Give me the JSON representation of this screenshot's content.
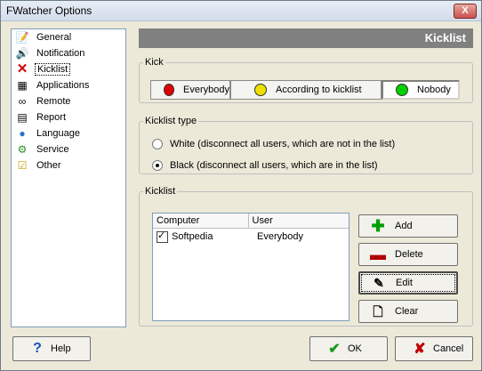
{
  "window": {
    "title": "FWatcher Options",
    "close_label": "X"
  },
  "nav": {
    "items": [
      {
        "label": "General",
        "icon": "general-icon"
      },
      {
        "label": "Notification",
        "icon": "speaker-icon"
      },
      {
        "label": "Kicklist",
        "icon": "x-icon"
      },
      {
        "label": "Applications",
        "icon": "applications-icon"
      },
      {
        "label": "Remote",
        "icon": "binoculars-icon"
      },
      {
        "label": "Report",
        "icon": "report-icon"
      },
      {
        "label": "Language",
        "icon": "globe-icon"
      },
      {
        "label": "Service",
        "icon": "service-icon"
      },
      {
        "label": "Other",
        "icon": "checkbox-icon"
      }
    ],
    "active_index": 2
  },
  "banner": {
    "title": "Kicklist"
  },
  "kick": {
    "legend": "Kick",
    "buttons": [
      {
        "label": "Everybody",
        "color": "#e00000"
      },
      {
        "label": "According to kicklist",
        "color": "#f0e000"
      },
      {
        "label": "Nobody",
        "color": "#00d000"
      }
    ]
  },
  "kicklist_type": {
    "legend": "Kicklist type",
    "options": [
      {
        "label": "White (disconnect all users, which are not in the list)",
        "checked": false
      },
      {
        "label": "Black (disconnect all users, which are in the list)",
        "checked": true
      }
    ]
  },
  "kicklist": {
    "legend": "Kicklist",
    "columns": [
      "Computer",
      "User"
    ],
    "rows": [
      {
        "computer": "Softpedia",
        "user": "Everybody",
        "checked": true
      }
    ],
    "buttons": {
      "add": "Add",
      "delete": "Delete",
      "edit": "Edit",
      "clear": "Clear"
    }
  },
  "bottom": {
    "help": "Help",
    "ok": "OK",
    "cancel": "Cancel"
  }
}
